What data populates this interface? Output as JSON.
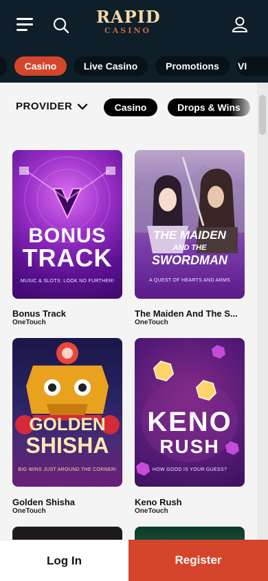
{
  "header": {
    "logo_top": "RAPID",
    "logo_bottom": "CASINO"
  },
  "nav": {
    "tabs": [
      {
        "label": "Casino",
        "active": true
      },
      {
        "label": "Live Casino",
        "active": false
      },
      {
        "label": "Promotions",
        "active": false
      },
      {
        "label": "VI",
        "active": false
      }
    ]
  },
  "filters": {
    "provider_label": "PROVIDER",
    "chips": [
      "Casino",
      "Drops & Wins"
    ]
  },
  "games": [
    {
      "title": "Bonus Track",
      "provider": "OneTouch",
      "art_line1": "BONUS",
      "art_line2": "TRACK",
      "art_caption": "MUSIC & SLOTS: LOOK NO FURTHER!"
    },
    {
      "title": "The Maiden And The S...",
      "provider": "OneTouch",
      "art_line1": "THE MAIDEN",
      "art_line2": "AND THE",
      "art_line3": "SWORDMAN",
      "art_caption": "A QUEST OF HEARTS AND ARMS"
    },
    {
      "title": "Golden Shisha",
      "provider": "OneTouch",
      "art_line1": "GOLDEN",
      "art_line2": "SHISHA",
      "art_caption": "BIG WINS JUST AROUND THE CORNER!"
    },
    {
      "title": "Keno Rush",
      "provider": "OneTouch",
      "art_line1": "KENO",
      "art_line2": "RUSH",
      "art_caption": "HOW GOOD IS YOUR GUESS?"
    }
  ],
  "footer": {
    "login_label": "Log In",
    "register_label": "Register"
  },
  "colors": {
    "header_bg": "#0f1f29",
    "accent": "#d4452b",
    "page_bg": "#f4f4f5"
  }
}
